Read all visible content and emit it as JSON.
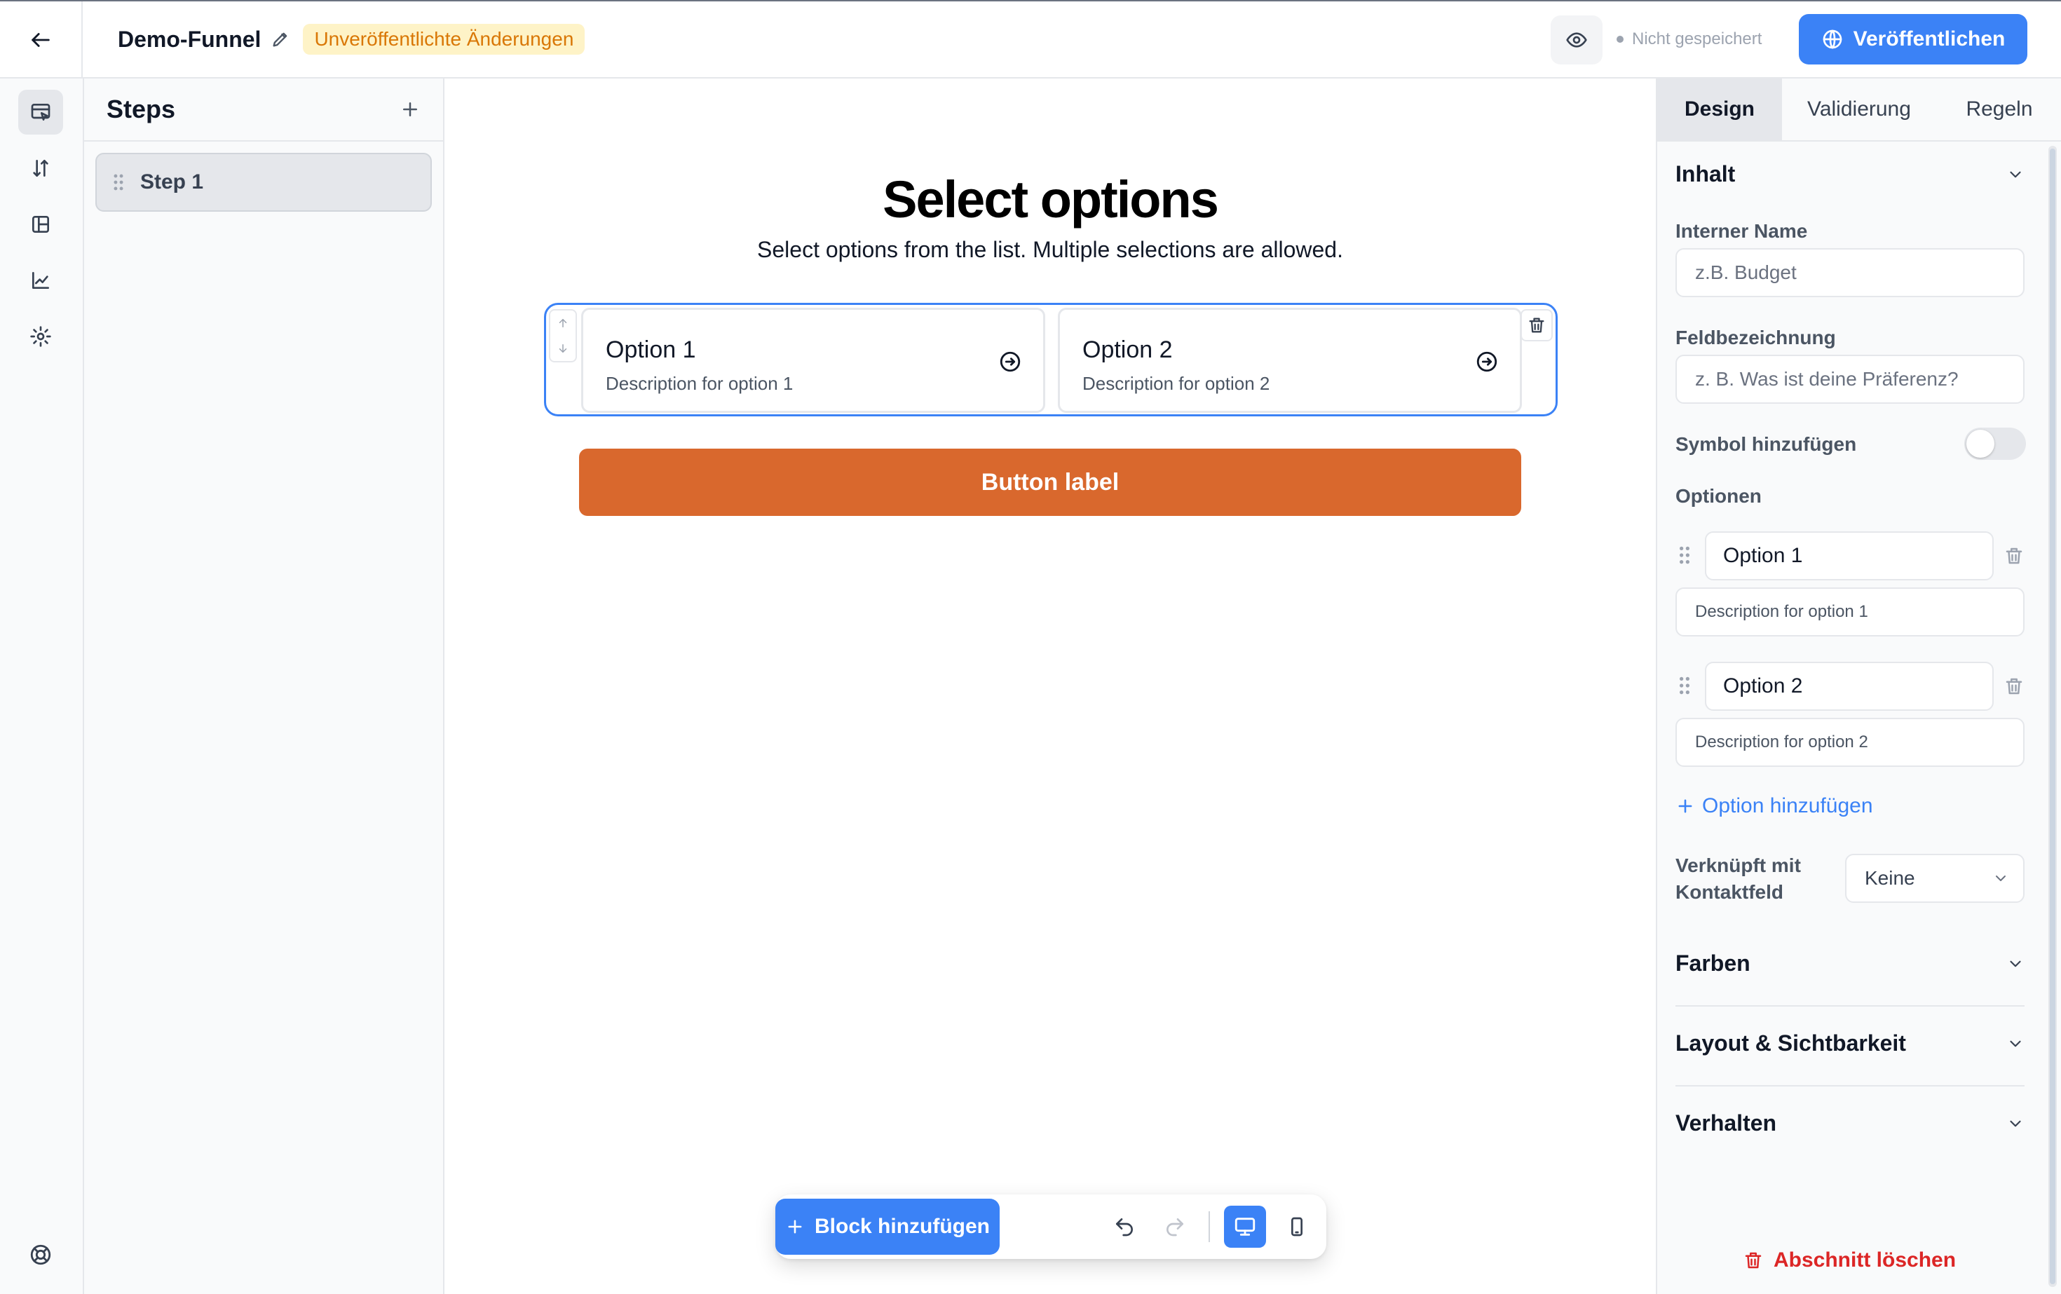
{
  "header": {
    "funnel_title": "Demo-Funnel",
    "unpublished_badge": "Unveröffentlichte Änderungen",
    "save_status": "Nicht gespeichert",
    "publish_label": "Veröffentlichen"
  },
  "rail": {
    "items": [
      "editor-icon",
      "sort-icon",
      "layout-icon",
      "analytics-icon",
      "settings-icon"
    ],
    "bottom": "help-icon"
  },
  "steps": {
    "title": "Steps",
    "items": [
      {
        "label": "Step 1"
      }
    ]
  },
  "canvas": {
    "heading": "Select options",
    "subheading": "Select options from the list. Multiple selections are allowed.",
    "options": [
      {
        "title": "Option 1",
        "description": "Description for option 1"
      },
      {
        "title": "Option 2",
        "description": "Description for option 2"
      }
    ],
    "button_label": "Button label",
    "button_color": "#d9682d"
  },
  "toolbar": {
    "add_block_label": "Block hinzufügen"
  },
  "properties": {
    "tabs": [
      {
        "label": "Design",
        "active": true
      },
      {
        "label": "Validierung",
        "active": false
      },
      {
        "label": "Regeln",
        "active": false
      }
    ],
    "content_section": "Inhalt",
    "internal_name_label": "Interner Name",
    "internal_name_placeholder": "z.B. Budget",
    "field_label_label": "Feldbezeichnung",
    "field_label_placeholder": "z. B. Was ist deine Präferenz?",
    "add_symbol_label": "Symbol hinzufügen",
    "add_symbol_enabled": false,
    "options_label": "Optionen",
    "options": [
      {
        "label": "Option 1",
        "description": "Description for option 1"
      },
      {
        "label": "Option 2",
        "description": "Description for option 2"
      }
    ],
    "add_option_label": "Option hinzufügen",
    "linked_contact_label": "Verknüpft mit Kontaktfeld",
    "linked_contact_value": "Keine",
    "sections": [
      "Farben",
      "Layout & Sichtbarkeit",
      "Verhalten"
    ],
    "delete_section_label": "Abschnitt löschen"
  },
  "colors": {
    "accent": "#3b82f6",
    "warning_bg": "#fef3c7",
    "warning_text": "#d97706",
    "danger": "#dc2626"
  }
}
